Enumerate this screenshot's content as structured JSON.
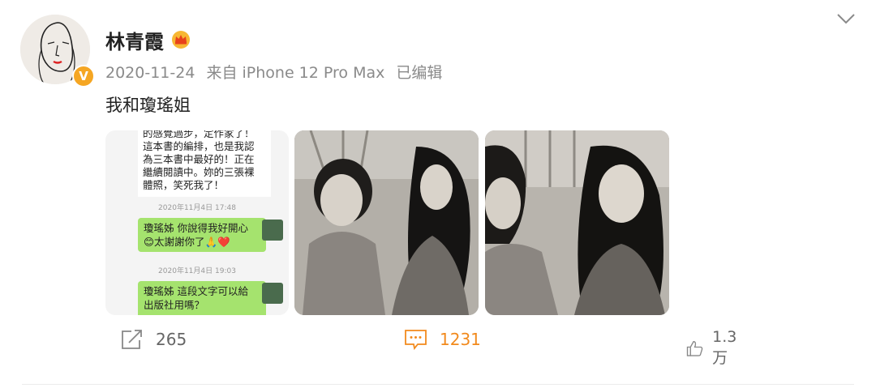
{
  "post": {
    "username": "林青霞",
    "date": "2020-11-24",
    "source": "来自 iPhone 12 Pro Max",
    "edited": "已编辑",
    "text": "我和瓊瑤姐"
  },
  "chat": {
    "message_lines": [
      "的感覺過步，定作家了！",
      "這本書的編排，也是我認",
      "為三本書中最好的！正在",
      "繼續閱讀中。妳的三張裸",
      "體照，笑死我了！"
    ],
    "time1": "2020年11月4日 17:48",
    "reply1_line1": "瓊瑤姊 你說得我好開心",
    "reply1_line2": "😊太謝謝你了🙏❤️",
    "time2": "2020年11月4日 19:03",
    "reply2_line1": "瓊瑤姊 這段文字可以給",
    "reply2_line2": "出版社用嗎？"
  },
  "actions": {
    "repost_count": "265",
    "comment_count": "1231",
    "like_count": "1.3万"
  },
  "colors": {
    "accent_orange": "#f28a1d",
    "verified": "#f5a623",
    "meta_gray": "#8a8a8a"
  },
  "icons": {
    "repost": "share-arrow-icon",
    "comment": "comment-bubble-icon",
    "like": "thumbs-up-icon",
    "menu": "chevron-down-icon",
    "vip": "crown-icon",
    "verified": "verified-v-icon"
  }
}
